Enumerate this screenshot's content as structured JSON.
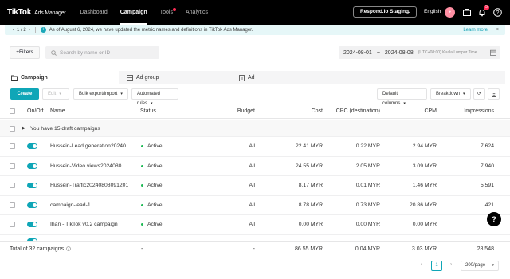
{
  "header": {
    "logo": "TikTok",
    "logo_sub": "Ads Manager",
    "nav": [
      "Dashboard",
      "Campaign",
      "Tools",
      "Analytics"
    ],
    "account": "Respond.io Staging",
    "language": "English",
    "notification_count": "5"
  },
  "notice": {
    "pager": "1 / 2",
    "message": "As of August 6, 2024, we have updated the metric names and definitions in TikTok Ads Manager.",
    "learn_more": "Learn more"
  },
  "filters": {
    "filter_label": "+Filters",
    "search_placeholder": "Search by name or ID",
    "date_start": "2024-08-01",
    "date_sep": "~",
    "date_end": "2024-08-08",
    "timezone": "(UTC+08:00) Kuala Lumpur Time"
  },
  "tabs": [
    "Campaign",
    "Ad group",
    "Ad"
  ],
  "toolbar": {
    "create": "Create",
    "edit": "Edit",
    "bulk": "Bulk export/import",
    "rules": "Automated rules",
    "columns": "Default columns",
    "breakdown": "Breakdown"
  },
  "table": {
    "columns": [
      "On/Off",
      "Name",
      "Status",
      "Budget",
      "Cost",
      "CPC (destination)",
      "CPM",
      "Impressions"
    ],
    "drafts_label": "You have 15 draft campaigns",
    "rows": [
      {
        "name": "Hussein-Lead generation20240...",
        "status": "Active",
        "budget": "All",
        "cost": "22.41 MYR",
        "cpc": "0.22 MYR",
        "cpm": "2.94 MYR",
        "impressions": "7,624"
      },
      {
        "name": "Hussein-Video views2024080...",
        "status": "Active",
        "budget": "All",
        "cost": "24.55 MYR",
        "cpc": "2.05 MYR",
        "cpm": "3.09 MYR",
        "impressions": "7,940"
      },
      {
        "name": "Hussein-Traffic20240808091201",
        "status": "Active",
        "budget": "All",
        "cost": "8.17 MYR",
        "cpc": "0.01 MYR",
        "cpm": "1.46 MYR",
        "impressions": "5,591"
      },
      {
        "name": "campaign-lead-1",
        "status": "Active",
        "budget": "All",
        "cost": "8.78 MYR",
        "cpc": "0.73 MYR",
        "cpm": "20.86 MYR",
        "impressions": "421"
      },
      {
        "name": "Ihan - TikTok v0.2 campaign",
        "status": "Active",
        "budget": "All",
        "cost": "0.00 MYR",
        "cpc": "0.00 MYR",
        "cpm": "0.00 MYR",
        "impressions": "0"
      }
    ]
  },
  "total": {
    "label": "Total of 32 campaigns",
    "status": "-",
    "budget": "-",
    "cost": "86.55 MYR",
    "cpc": "0.04 MYR",
    "cpm": "3.03 MYR",
    "impressions": "28,548"
  },
  "pagination": {
    "current": "1",
    "page_size": "200/page"
  },
  "help": "?"
}
